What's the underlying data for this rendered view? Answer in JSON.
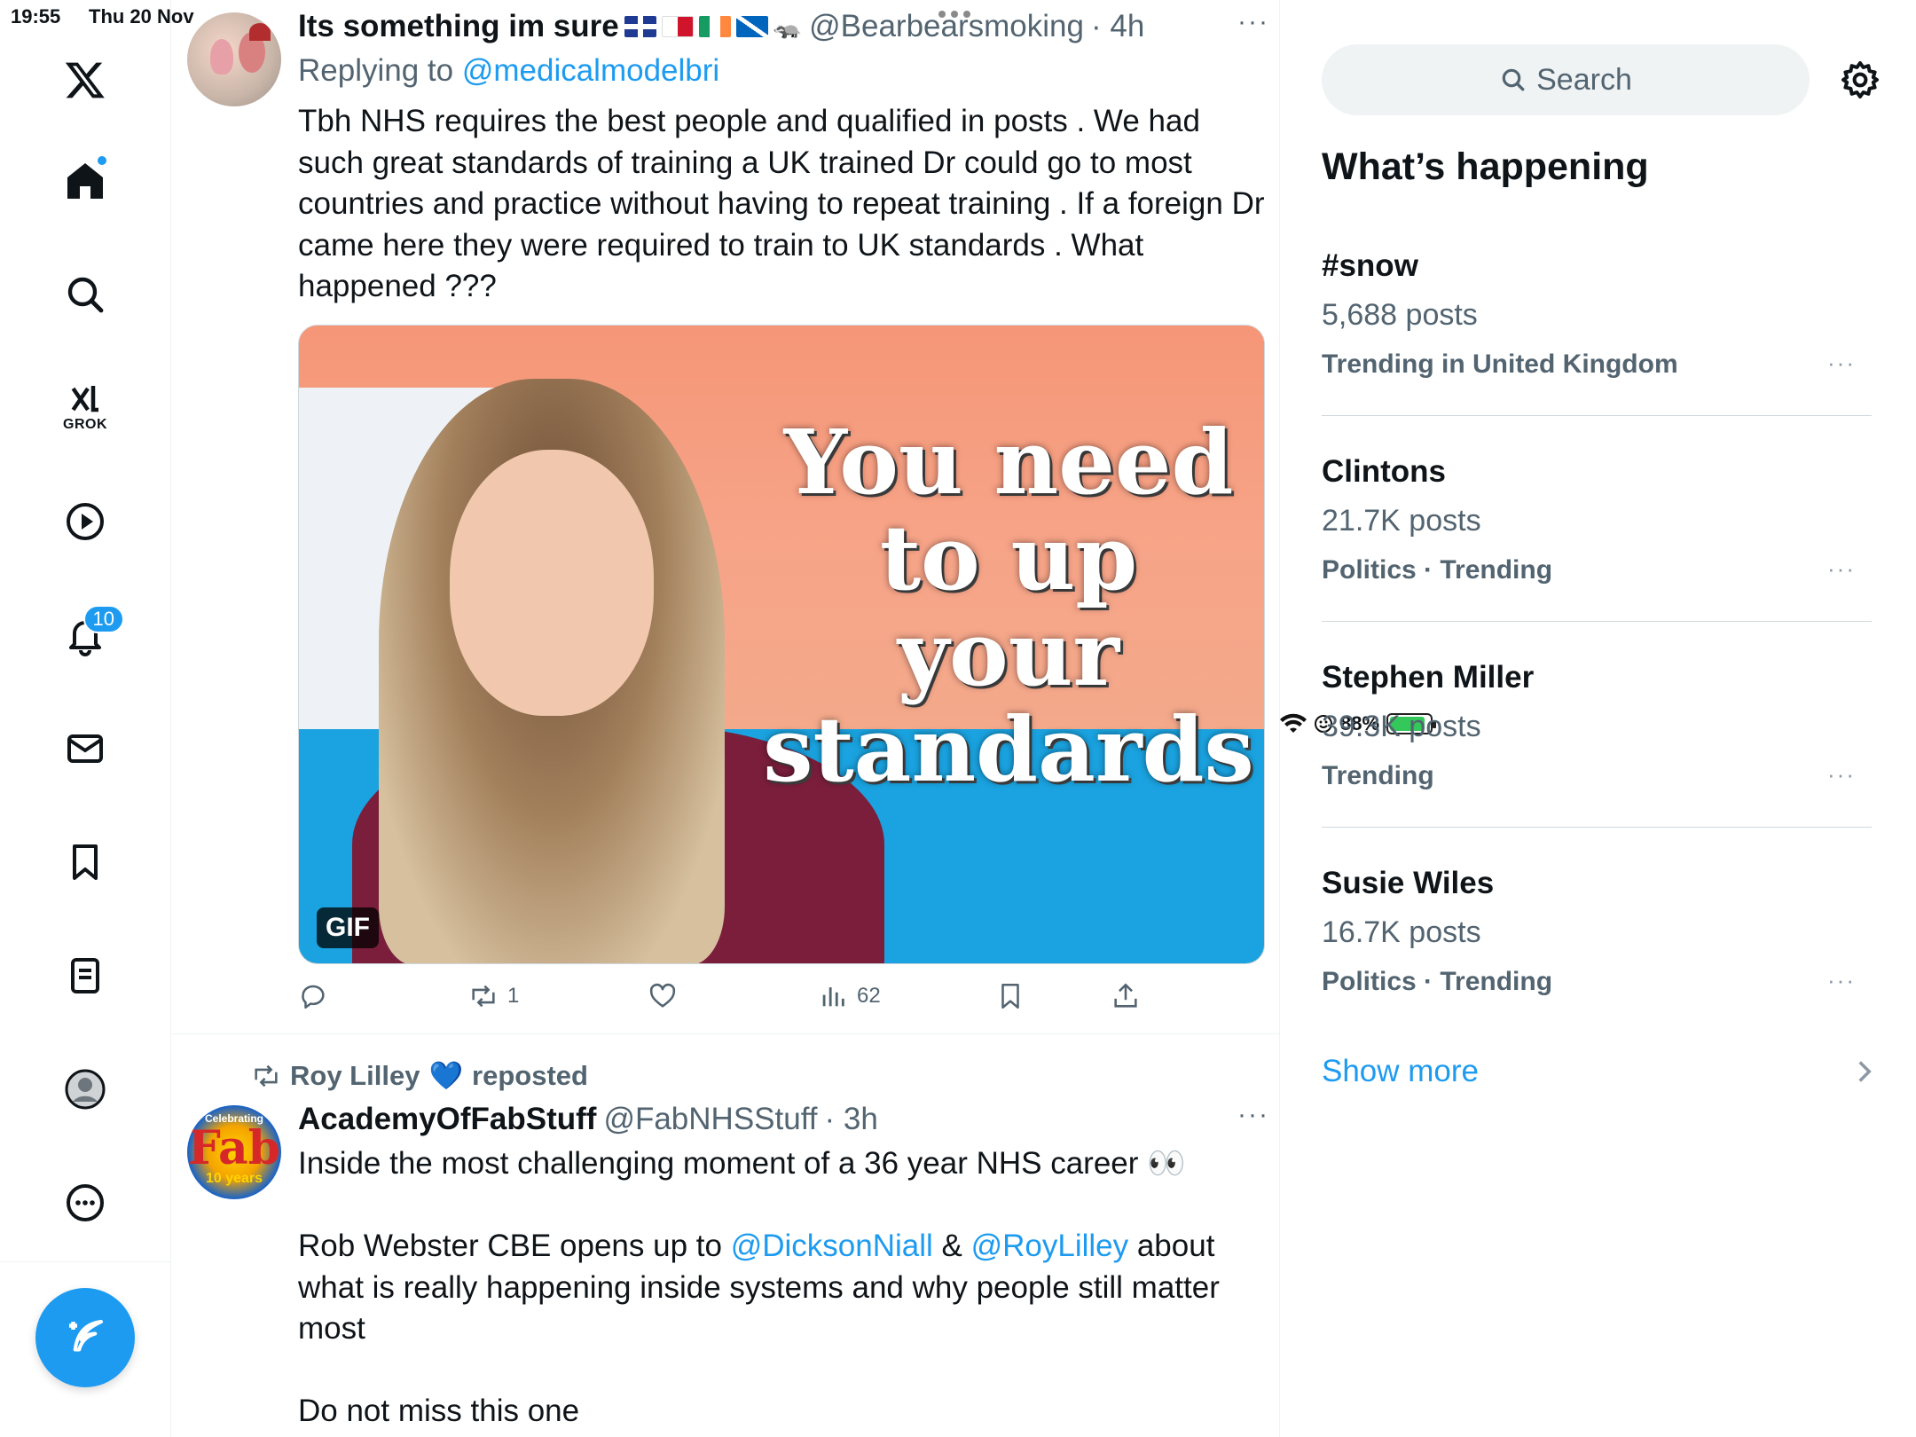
{
  "status": {
    "time": "19:55",
    "date": "Thu 20 Nov",
    "battery": "88%",
    "battery_level": 0.88
  },
  "nav": {
    "grok_label": "GROK",
    "notifications_count": "10"
  },
  "tweet1": {
    "name": "Its something im sure",
    "handle": "@Bearbearsmoking",
    "time": "· 4h",
    "replying_prefix": "Replying to ",
    "replying_to": "@medicalmodelbri",
    "text": "Tbh NHS requires the best people and qualified in posts . We had such great standards of training a UK trained Dr could go to most countries and practice without having to repeat training . If a foreign Dr came here they were required to train to UK standards . What happened ???",
    "media_caption": "You need to up your standards",
    "media_badge": "GIF",
    "reposts": "1",
    "views": "62"
  },
  "tweet2": {
    "repost_by": "Roy Lilley",
    "repost_suffix": "reposted",
    "avatar_top": "Celebrating",
    "avatar_mid": "Fab",
    "avatar_bottom": "10 years",
    "name": "AcademyOfFabStuff",
    "handle": "@FabNHSStuff",
    "time": "· 3h",
    "line1": "Inside the most challenging moment of a 36 year NHS career 👀",
    "line2_a": "Rob Webster CBE opens up to ",
    "mention1": "@DicksonNiall",
    "line2_b": " & ",
    "mention2": "@RoyLilley",
    "line2_c": " about what is really happening inside systems and why people still matter most",
    "line3": "Do not miss this one"
  },
  "sidebar": {
    "search_placeholder": "Search",
    "heading": "What’s happening",
    "trends": [
      {
        "title": "#snow",
        "count": "5,688 posts",
        "meta": "Trending in United Kingdom"
      },
      {
        "title": "Clintons",
        "count": "21.7K posts",
        "meta": "Politics · Trending"
      },
      {
        "title": "Stephen Miller",
        "count": "39.3K posts",
        "meta": "Trending"
      },
      {
        "title": "Susie Wiles",
        "count": "16.7K posts",
        "meta": "Politics · Trending"
      }
    ],
    "show_more": "Show more"
  },
  "colors": {
    "accent": "#1d9bf0",
    "secondary_text": "#536471",
    "text": "#0f1419"
  }
}
